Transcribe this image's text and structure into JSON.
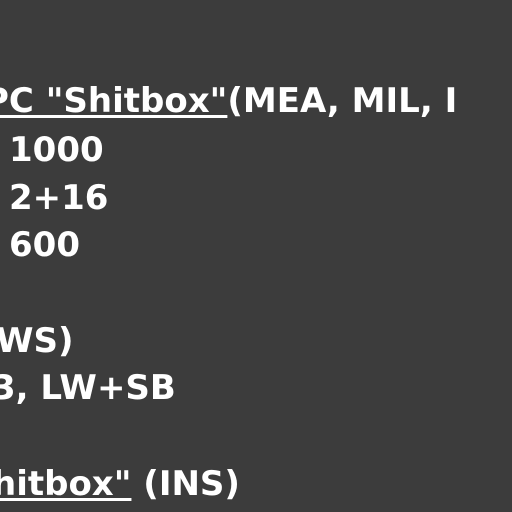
{
  "lines": {
    "heading_underlined": "PC \"Shitbox\"",
    "heading_rest": "(MEA, MIL, I",
    "value_1": "1000",
    "value_2": "2+16",
    "value_3": "600",
    "line_5": "WS)",
    "line_6": "3, LW+SB",
    "footer_underlined": "hitbox\"",
    "footer_rest": " (INS)"
  }
}
